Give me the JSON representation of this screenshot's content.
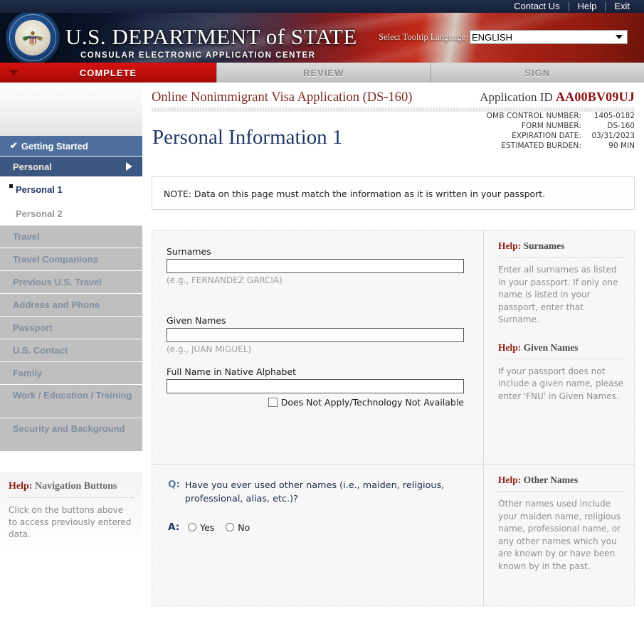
{
  "topbar": {
    "links": [
      "Contact Us",
      "Help",
      "Exit"
    ]
  },
  "banner": {
    "seal_alt": "us-department-of-state-seal",
    "title_prefix": "U.S. ",
    "title_dept": "D",
    "title_dept_rest": "EPARTMENT",
    "title_of": " of ",
    "title_state_cap": "S",
    "title_state_rest": "TATE",
    "title_full": "U.S. DEPARTMENT of STATE",
    "subtitle": "CONSULAR ELECTRONIC APPLICATION CENTER",
    "language_label": "Select Tooltip Language",
    "language_value": "ENGLISH",
    "language_options": [
      "ENGLISH"
    ]
  },
  "tabs": [
    {
      "label": "COMPLETE",
      "state": "active"
    },
    {
      "label": "REVIEW",
      "state": "idle"
    },
    {
      "label": "SIGN",
      "state": "idle"
    }
  ],
  "sidebar": {
    "items": [
      {
        "label": "Getting Started",
        "style": "done"
      },
      {
        "label": "Personal",
        "style": "current"
      }
    ],
    "subitems": [
      {
        "label": "Personal 1",
        "style": "active"
      },
      {
        "label": "Personal 2",
        "style": "inactive"
      }
    ],
    "rest": [
      {
        "label": "Travel",
        "lines": 1
      },
      {
        "label": "Travel Companions",
        "lines": 1
      },
      {
        "label": "Previous U.S. Travel",
        "lines": 1
      },
      {
        "label": "Address and Phone",
        "lines": 1
      },
      {
        "label": "Passport",
        "lines": 1
      },
      {
        "label": "U.S. Contact",
        "lines": 1
      },
      {
        "label": "Family",
        "lines": 1
      },
      {
        "label": "Work / Education / Training",
        "lines": 2
      },
      {
        "label": "Security and Background",
        "lines": 2
      }
    ],
    "help": {
      "title_key": "Help:",
      "title_topic": " Navigation Buttons",
      "body": "Click on the buttons above to access previously entered data."
    }
  },
  "main": {
    "app_title": "Online Nonimmigrant Visa Application (DS-160)",
    "app_id_label": "Application ID ",
    "app_id_value": "AA00BV09UJ",
    "meta": [
      {
        "key": "OMB CONTROL NUMBER:",
        "value": "1405-0182"
      },
      {
        "key": "FORM NUMBER:",
        "value": "DS-160"
      },
      {
        "key": "EXPIRATION DATE:",
        "value": "03/31/2023"
      },
      {
        "key": "ESTIMATED BURDEN:",
        "value": "90 MIN"
      }
    ],
    "page_title": "Personal Information 1",
    "note": "NOTE: Data on this page must match the information as it is written in your passport.",
    "fields": [
      {
        "label": "Surnames",
        "value": "",
        "hint": "(e.g., FERNANDEZ GARCIA)"
      },
      {
        "label": "Given Names",
        "value": "",
        "hint": "(e.g., JUAN MIGUEL)"
      },
      {
        "label": "Full Name in Native Alphabet",
        "value": "",
        "hint": ""
      }
    ],
    "checkbox": {
      "label": "Does Not Apply/Technology Not Available",
      "checked": false
    },
    "help_blocks": [
      {
        "title_key": "Help:",
        "title_topic": " Surnames",
        "body": "Enter all surnames as listed in your passport. If only one name is listed in your passport, enter that Surname."
      },
      {
        "title_key": "Help:",
        "title_topic": " Given Names",
        "body": "If your passport does not include a given name, please enter 'FNU' in Given Names."
      }
    ],
    "question": {
      "q_tag": "Q:",
      "q_text": "Have you ever used other names (i.e., maiden, religious, professional, alias, etc.)?",
      "a_tag": "A:",
      "options": [
        {
          "label": "Yes",
          "selected": false
        },
        {
          "label": "No",
          "selected": false
        }
      ]
    },
    "question_help": {
      "title_key": "Help:",
      "title_topic": " Other Names",
      "body": "Other names used include your maiden name, religious name, professional name, or any other names which you are known by or have been known by in the past."
    }
  },
  "colors": {
    "navy_bar": "#1b2744",
    "banner_red": "#a81f18",
    "tab_active_red": "#c30f0c",
    "sidebar_done": "#4e6e9e",
    "sidebar_current": "#3c5682",
    "sidebar_grey": "#bfbfbf",
    "heading_blue": "#1f3864",
    "accent_dark_red": "#8b0f12",
    "help_key_red": "#8b1a12"
  }
}
